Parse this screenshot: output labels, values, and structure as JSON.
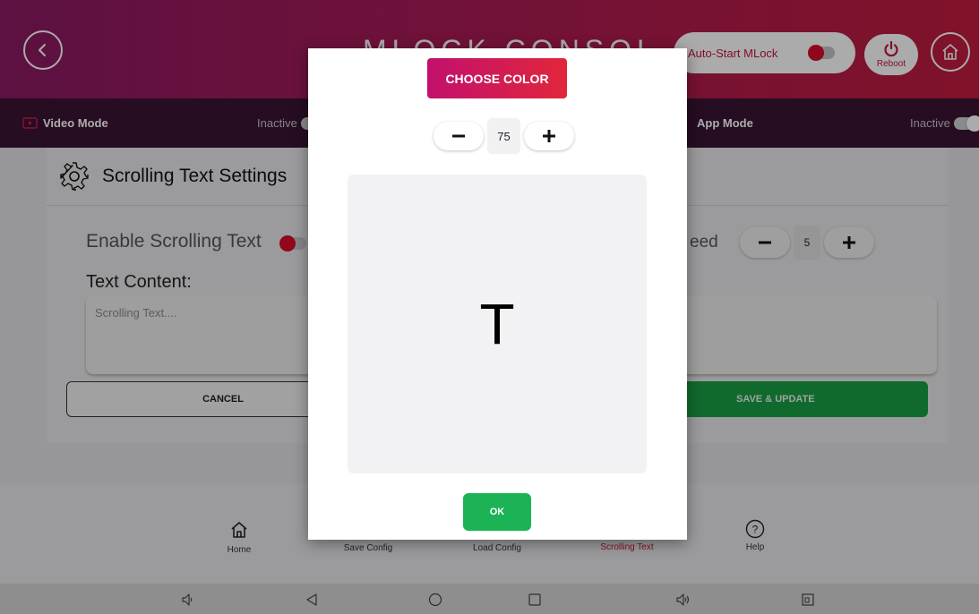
{
  "header": {
    "title": "MLOCK CONSOLE",
    "autostart_label": "Auto-Start MLock",
    "autostart_enabled": false,
    "reboot_label": "Reboot"
  },
  "modebar": {
    "video_mode_label": "Video Mode",
    "video_mode_status": "Inactive",
    "app_mode_label": "App Mode",
    "app_mode_status": "Inactive"
  },
  "settings": {
    "title": "Scrolling Text Settings",
    "enable_label": "Enable Scrolling Text",
    "enable_value": false,
    "text_content_label": "Text Content:",
    "text_placeholder": "Scrolling Text....",
    "speed_label_visible": "eed",
    "speed_value": "5",
    "cancel_label": "CANCEL",
    "save_label": "SAVE & UPDATE"
  },
  "bottomnav": {
    "items": [
      {
        "label": "Home",
        "icon": "home-icon"
      },
      {
        "label": "Save Config",
        "icon": "save-icon"
      },
      {
        "label": "Load Config",
        "icon": "load-icon"
      },
      {
        "label": "Scrolling Text",
        "icon": "scrolling-text-icon",
        "active": true
      },
      {
        "label": "Help",
        "icon": "help-icon"
      }
    ]
  },
  "system_bar": {
    "icons": [
      "volume-down-icon",
      "back-icon",
      "home-circle-icon",
      "recents-icon",
      "volume-up-icon",
      "screenshot-icon"
    ]
  },
  "dialog": {
    "choose_color_label": "CHOOSE COLOR",
    "size_value": "75",
    "preview_text": "T",
    "ok_label": "OK"
  },
  "colors": {
    "accent": "#c0163b",
    "header_start": "#8a1a63",
    "header_end": "#c01c3e",
    "modebar": "#3a1434",
    "ok_green": "#1cb356",
    "save_green": "#1a9f43"
  }
}
